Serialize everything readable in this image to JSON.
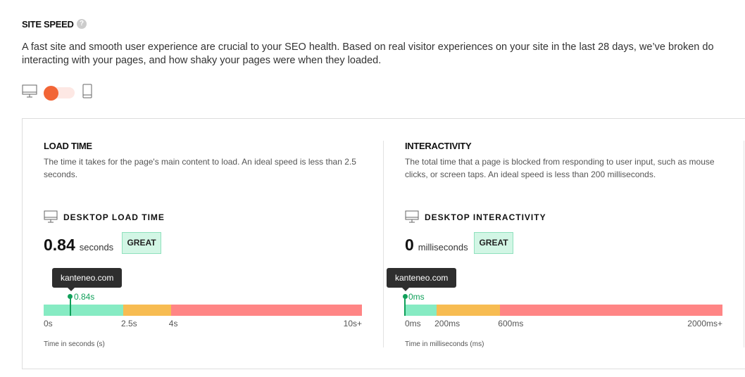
{
  "header": {
    "title": "SITE SPEED",
    "help_icon": "question-circle-icon",
    "help_glyph": "?",
    "description_line1": "A fast site and smooth user experience are crucial to your SEO health. Based on real visitor experiences on your site in the last 28 days, we’ve broken do",
    "description_line2": "interacting with your pages, and how shaky your pages were when they loaded."
  },
  "device_toggle": {
    "selected": "desktop",
    "left_icon": "desktop-icon",
    "right_icon": "mobile-icon"
  },
  "colors": {
    "accent": "#f26536",
    "good": "#86ebc3",
    "medium": "#f7bc52",
    "poor": "#ff8585",
    "marker": "#10a05a"
  },
  "load_time": {
    "title": "LOAD TIME",
    "description_line1": "The time it takes for the page's main content to load. An ideal speed is less than 2.5",
    "description_line2": "seconds.",
    "subtitle": "DESKTOP LOAD TIME",
    "value": "0.84",
    "unit": "seconds",
    "rating": "GREAT",
    "site": "kanteneo.com",
    "marker_label": "0.84s",
    "marker_value": 0.84,
    "scale_max": 10,
    "thresholds": [
      2.5,
      4
    ],
    "ticks": [
      "0s",
      "2.5s",
      "4s",
      "10s+"
    ],
    "axis_label": "Time in seconds (s)"
  },
  "interactivity": {
    "title": "INTERACTIVITY",
    "description_line1": "The total time that a page is blocked from responding to user input, such as mouse",
    "description_line2": "clicks, or screen taps. An ideal speed is less than 200 milliseconds.",
    "subtitle": "DESKTOP INTERACTIVITY",
    "value": "0",
    "unit": "milliseconds",
    "rating": "GREAT",
    "site": "kanteneo.com",
    "marker_label": "0ms",
    "marker_value": 0,
    "scale_max": 2000,
    "thresholds": [
      200,
      600
    ],
    "ticks": [
      "0ms",
      "200ms",
      "600ms",
      "2000ms+"
    ],
    "axis_label": "Time in milliseconds (ms)"
  }
}
